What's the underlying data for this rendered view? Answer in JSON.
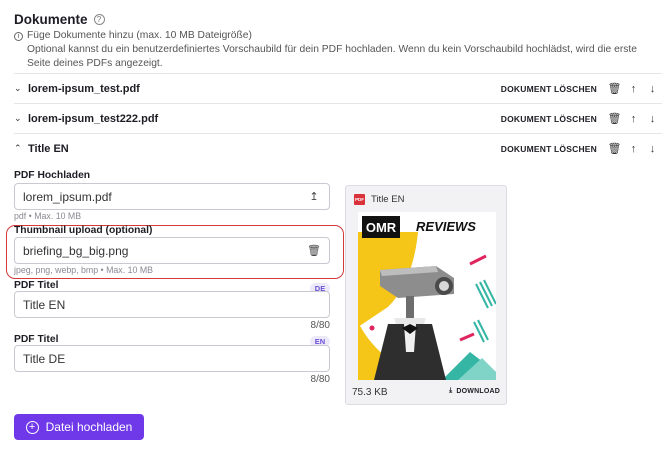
{
  "section": {
    "title": "Dokumente",
    "help_icon": "help-circle-icon",
    "info_line1": "Füge Dokumente hinzu (max. 10 MB Dateigröße)",
    "info_line2": "Optional kannst du ein benutzerdefiniertes Vorschaubild für dein PDF hochladen. Wenn du kein Vorschaubild hochlädst, wird die erste",
    "info_line3": "Seite deines PDFs angezeigt."
  },
  "documents": [
    {
      "name": "lorem-ipsum_test.pdf",
      "expanded": false,
      "delete_label": "DOKUMENT LÖSCHEN"
    },
    {
      "name": "lorem-ipsum_test222.pdf",
      "expanded": false,
      "delete_label": "DOKUMENT LÖSCHEN"
    },
    {
      "name": "Title EN",
      "expanded": true,
      "delete_label": "DOKUMENT LÖSCHEN"
    }
  ],
  "form": {
    "pdf_label": "PDF Hochladen",
    "pdf_value": "lorem_ipsum.pdf",
    "pdf_hint": "pdf  •  Max. 10 MB",
    "thumb_label": "Thumbnail upload (optional)",
    "thumb_value": "briefing_bg_big.png",
    "thumb_hint": "jpeg, png, webp, bmp  •  Max. 10 MB",
    "title_en_label": "PDF Titel",
    "title_en_lang": "DE",
    "title_en_value": "Title EN",
    "title_en_count": "8/80",
    "title_de_label": "PDF Titel",
    "title_de_lang": "EN",
    "title_de_value": "Title DE",
    "title_de_count": "8/80"
  },
  "preview": {
    "badge": "PDF",
    "title": "Title EN",
    "size": "75.3 KB",
    "download_label": "DOWNLOAD",
    "thumb_text_omr": "OMR",
    "thumb_text_reviews": "REVIEWS",
    "colors": {
      "yellow": "#f5c518",
      "teal": "#35b6a4",
      "magenta": "#e0245e"
    }
  },
  "upload_button": {
    "label": "Datei hochladen"
  }
}
